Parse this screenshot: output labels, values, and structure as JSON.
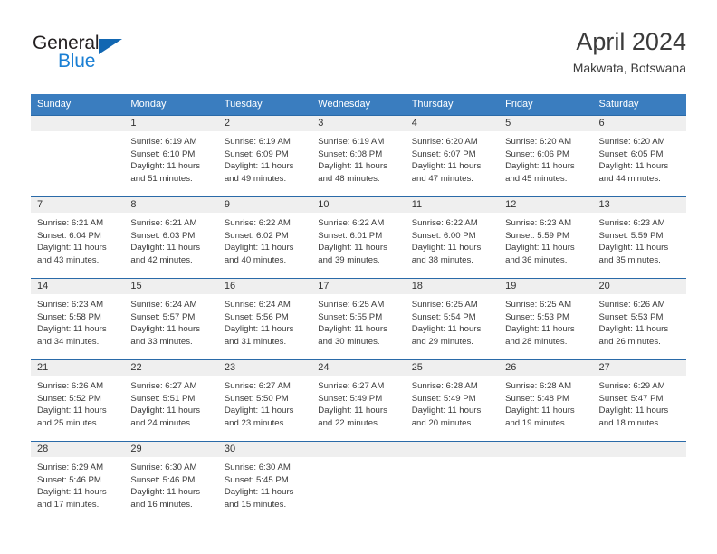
{
  "brand": {
    "name_part1": "General",
    "name_part2": "Blue",
    "triangle_color": "#1267b2",
    "blue_color": "#1a7fd4"
  },
  "header": {
    "title": "April 2024",
    "location": "Makwata, Botswana"
  },
  "theme": {
    "header_bg": "#3a7dbf",
    "header_text": "#ffffff",
    "daynum_strip_bg": "#efefef",
    "row_divider": "#2a6aa8",
    "body_text": "#3a3a3a"
  },
  "weekday_headers": [
    "Sunday",
    "Monday",
    "Tuesday",
    "Wednesday",
    "Thursday",
    "Friday",
    "Saturday"
  ],
  "labels": {
    "sunrise_prefix": "Sunrise:",
    "sunset_prefix": "Sunset:",
    "daylight_prefix": "Daylight:"
  },
  "weeks": [
    [
      {
        "day": "",
        "sunrise": "",
        "sunset": "",
        "daylight_line1": "",
        "daylight_line2": ""
      },
      {
        "day": "1",
        "sunrise": "Sunrise: 6:19 AM",
        "sunset": "Sunset: 6:10 PM",
        "daylight_line1": "Daylight: 11 hours",
        "daylight_line2": "and 51 minutes."
      },
      {
        "day": "2",
        "sunrise": "Sunrise: 6:19 AM",
        "sunset": "Sunset: 6:09 PM",
        "daylight_line1": "Daylight: 11 hours",
        "daylight_line2": "and 49 minutes."
      },
      {
        "day": "3",
        "sunrise": "Sunrise: 6:19 AM",
        "sunset": "Sunset: 6:08 PM",
        "daylight_line1": "Daylight: 11 hours",
        "daylight_line2": "and 48 minutes."
      },
      {
        "day": "4",
        "sunrise": "Sunrise: 6:20 AM",
        "sunset": "Sunset: 6:07 PM",
        "daylight_line1": "Daylight: 11 hours",
        "daylight_line2": "and 47 minutes."
      },
      {
        "day": "5",
        "sunrise": "Sunrise: 6:20 AM",
        "sunset": "Sunset: 6:06 PM",
        "daylight_line1": "Daylight: 11 hours",
        "daylight_line2": "and 45 minutes."
      },
      {
        "day": "6",
        "sunrise": "Sunrise: 6:20 AM",
        "sunset": "Sunset: 6:05 PM",
        "daylight_line1": "Daylight: 11 hours",
        "daylight_line2": "and 44 minutes."
      }
    ],
    [
      {
        "day": "7",
        "sunrise": "Sunrise: 6:21 AM",
        "sunset": "Sunset: 6:04 PM",
        "daylight_line1": "Daylight: 11 hours",
        "daylight_line2": "and 43 minutes."
      },
      {
        "day": "8",
        "sunrise": "Sunrise: 6:21 AM",
        "sunset": "Sunset: 6:03 PM",
        "daylight_line1": "Daylight: 11 hours",
        "daylight_line2": "and 42 minutes."
      },
      {
        "day": "9",
        "sunrise": "Sunrise: 6:22 AM",
        "sunset": "Sunset: 6:02 PM",
        "daylight_line1": "Daylight: 11 hours",
        "daylight_line2": "and 40 minutes."
      },
      {
        "day": "10",
        "sunrise": "Sunrise: 6:22 AM",
        "sunset": "Sunset: 6:01 PM",
        "daylight_line1": "Daylight: 11 hours",
        "daylight_line2": "and 39 minutes."
      },
      {
        "day": "11",
        "sunrise": "Sunrise: 6:22 AM",
        "sunset": "Sunset: 6:00 PM",
        "daylight_line1": "Daylight: 11 hours",
        "daylight_line2": "and 38 minutes."
      },
      {
        "day": "12",
        "sunrise": "Sunrise: 6:23 AM",
        "sunset": "Sunset: 5:59 PM",
        "daylight_line1": "Daylight: 11 hours",
        "daylight_line2": "and 36 minutes."
      },
      {
        "day": "13",
        "sunrise": "Sunrise: 6:23 AM",
        "sunset": "Sunset: 5:59 PM",
        "daylight_line1": "Daylight: 11 hours",
        "daylight_line2": "and 35 minutes."
      }
    ],
    [
      {
        "day": "14",
        "sunrise": "Sunrise: 6:23 AM",
        "sunset": "Sunset: 5:58 PM",
        "daylight_line1": "Daylight: 11 hours",
        "daylight_line2": "and 34 minutes."
      },
      {
        "day": "15",
        "sunrise": "Sunrise: 6:24 AM",
        "sunset": "Sunset: 5:57 PM",
        "daylight_line1": "Daylight: 11 hours",
        "daylight_line2": "and 33 minutes."
      },
      {
        "day": "16",
        "sunrise": "Sunrise: 6:24 AM",
        "sunset": "Sunset: 5:56 PM",
        "daylight_line1": "Daylight: 11 hours",
        "daylight_line2": "and 31 minutes."
      },
      {
        "day": "17",
        "sunrise": "Sunrise: 6:25 AM",
        "sunset": "Sunset: 5:55 PM",
        "daylight_line1": "Daylight: 11 hours",
        "daylight_line2": "and 30 minutes."
      },
      {
        "day": "18",
        "sunrise": "Sunrise: 6:25 AM",
        "sunset": "Sunset: 5:54 PM",
        "daylight_line1": "Daylight: 11 hours",
        "daylight_line2": "and 29 minutes."
      },
      {
        "day": "19",
        "sunrise": "Sunrise: 6:25 AM",
        "sunset": "Sunset: 5:53 PM",
        "daylight_line1": "Daylight: 11 hours",
        "daylight_line2": "and 28 minutes."
      },
      {
        "day": "20",
        "sunrise": "Sunrise: 6:26 AM",
        "sunset": "Sunset: 5:53 PM",
        "daylight_line1": "Daylight: 11 hours",
        "daylight_line2": "and 26 minutes."
      }
    ],
    [
      {
        "day": "21",
        "sunrise": "Sunrise: 6:26 AM",
        "sunset": "Sunset: 5:52 PM",
        "daylight_line1": "Daylight: 11 hours",
        "daylight_line2": "and 25 minutes."
      },
      {
        "day": "22",
        "sunrise": "Sunrise: 6:27 AM",
        "sunset": "Sunset: 5:51 PM",
        "daylight_line1": "Daylight: 11 hours",
        "daylight_line2": "and 24 minutes."
      },
      {
        "day": "23",
        "sunrise": "Sunrise: 6:27 AM",
        "sunset": "Sunset: 5:50 PM",
        "daylight_line1": "Daylight: 11 hours",
        "daylight_line2": "and 23 minutes."
      },
      {
        "day": "24",
        "sunrise": "Sunrise: 6:27 AM",
        "sunset": "Sunset: 5:49 PM",
        "daylight_line1": "Daylight: 11 hours",
        "daylight_line2": "and 22 minutes."
      },
      {
        "day": "25",
        "sunrise": "Sunrise: 6:28 AM",
        "sunset": "Sunset: 5:49 PM",
        "daylight_line1": "Daylight: 11 hours",
        "daylight_line2": "and 20 minutes."
      },
      {
        "day": "26",
        "sunrise": "Sunrise: 6:28 AM",
        "sunset": "Sunset: 5:48 PM",
        "daylight_line1": "Daylight: 11 hours",
        "daylight_line2": "and 19 minutes."
      },
      {
        "day": "27",
        "sunrise": "Sunrise: 6:29 AM",
        "sunset": "Sunset: 5:47 PM",
        "daylight_line1": "Daylight: 11 hours",
        "daylight_line2": "and 18 minutes."
      }
    ],
    [
      {
        "day": "28",
        "sunrise": "Sunrise: 6:29 AM",
        "sunset": "Sunset: 5:46 PM",
        "daylight_line1": "Daylight: 11 hours",
        "daylight_line2": "and 17 minutes."
      },
      {
        "day": "29",
        "sunrise": "Sunrise: 6:30 AM",
        "sunset": "Sunset: 5:46 PM",
        "daylight_line1": "Daylight: 11 hours",
        "daylight_line2": "and 16 minutes."
      },
      {
        "day": "30",
        "sunrise": "Sunrise: 6:30 AM",
        "sunset": "Sunset: 5:45 PM",
        "daylight_line1": "Daylight: 11 hours",
        "daylight_line2": "and 15 minutes."
      },
      {
        "day": "",
        "sunrise": "",
        "sunset": "",
        "daylight_line1": "",
        "daylight_line2": ""
      },
      {
        "day": "",
        "sunrise": "",
        "sunset": "",
        "daylight_line1": "",
        "daylight_line2": ""
      },
      {
        "day": "",
        "sunrise": "",
        "sunset": "",
        "daylight_line1": "",
        "daylight_line2": ""
      },
      {
        "day": "",
        "sunrise": "",
        "sunset": "",
        "daylight_line1": "",
        "daylight_line2": ""
      }
    ]
  ]
}
